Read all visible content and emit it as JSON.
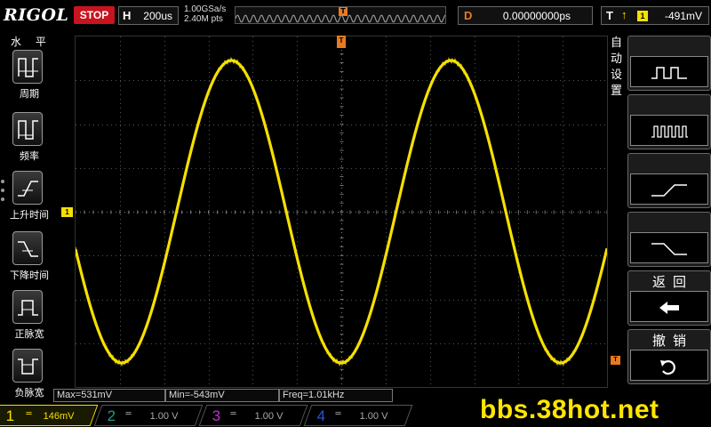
{
  "topbar": {
    "brand": "RIGOL",
    "run_state": "STOP",
    "horizontal": {
      "key": "H",
      "timebase": "200us"
    },
    "sample_rate": "1.00GSa/s",
    "memory_depth": "2.40M pts",
    "trig_pos_marker": "T",
    "delay": {
      "key": "D",
      "value": "0.00000000ps"
    },
    "trigger": {
      "key": "T",
      "channel": "1",
      "level": "-491mV"
    }
  },
  "left_menu": {
    "title": "水 平",
    "items": [
      {
        "label": "周期",
        "icon": "period-icon"
      },
      {
        "label": "频率",
        "icon": "frequency-icon"
      },
      {
        "label": "上升时间",
        "icon": "rise-time-icon"
      },
      {
        "label": "下降时间",
        "icon": "fall-time-icon"
      },
      {
        "label": "正脉宽",
        "icon": "positive-width-icon"
      },
      {
        "label": "负脉宽",
        "icon": "negative-width-icon"
      }
    ]
  },
  "right_menu": {
    "title": "自动设置",
    "items": [
      {
        "icon": "multi-period-icon"
      },
      {
        "icon": "single-period-icon"
      },
      {
        "icon": "rising-edge-icon"
      },
      {
        "icon": "falling-edge-icon"
      },
      {
        "label": "返回",
        "icon": "back-arrow-icon"
      },
      {
        "label": "撤销",
        "icon": "undo-icon"
      }
    ]
  },
  "screen": {
    "ch1_marker": "1",
    "trig_pos_marker": "T",
    "trig_level_marker": "T",
    "trace_color": "#f5e000"
  },
  "measurements": [
    "Max=531mV",
    "Min=-543mV",
    "Freq=1.01kHz"
  ],
  "channels": [
    {
      "num": "1",
      "scale": "146mV",
      "active": true,
      "color": "#f5e000"
    },
    {
      "num": "2",
      "scale": "1.00 V",
      "active": false,
      "color": "#1e9c8c"
    },
    {
      "num": "3",
      "scale": "1.00 V",
      "active": false,
      "color": "#c030c8"
    },
    {
      "num": "4",
      "scale": "1.00 V",
      "active": false,
      "color": "#3050d8"
    }
  ],
  "watermark": "bbs.38hot.net"
}
